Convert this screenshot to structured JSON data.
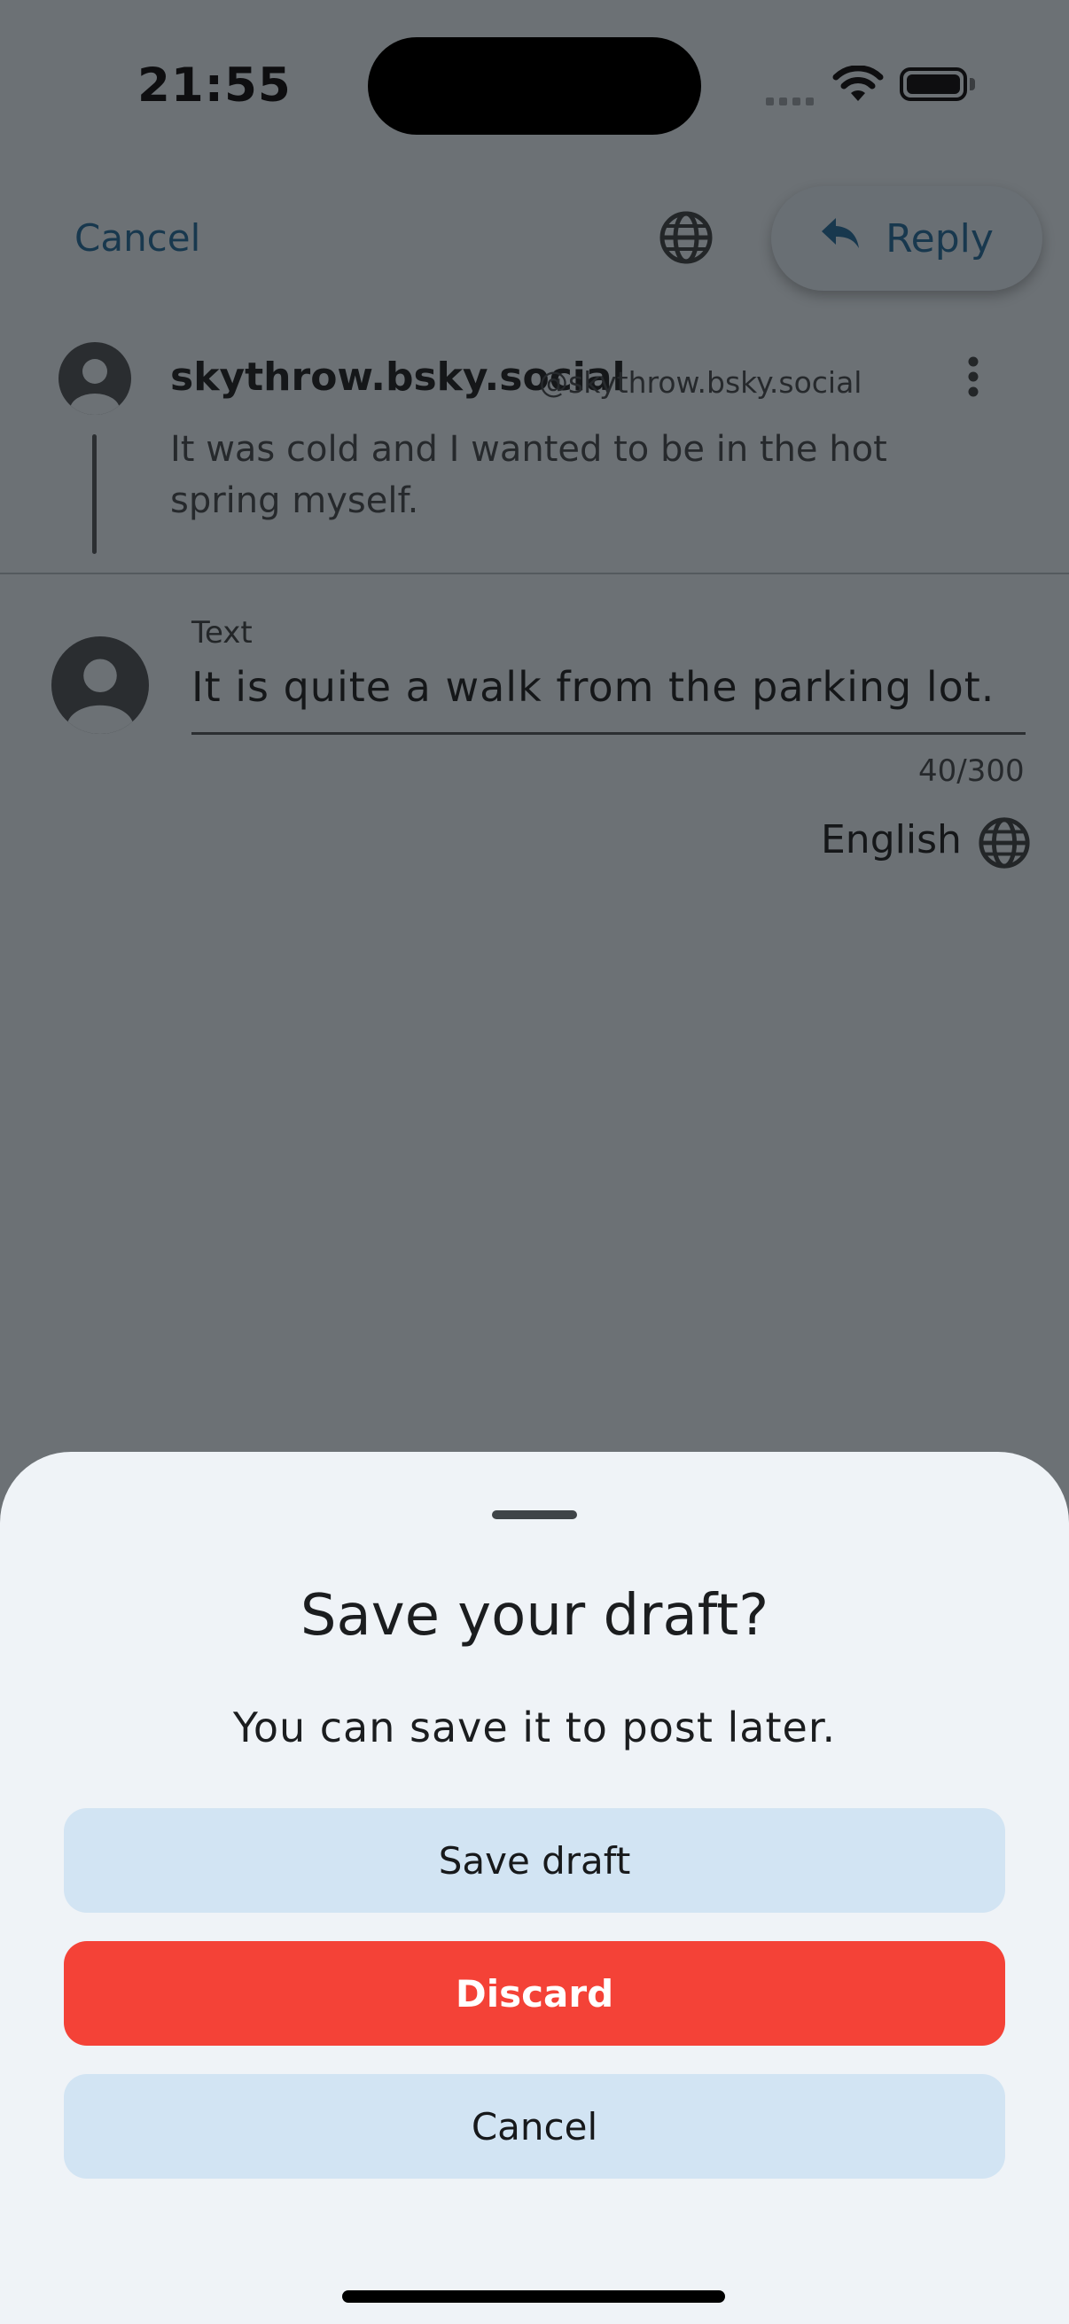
{
  "status_bar": {
    "time": "21:55"
  },
  "header": {
    "cancel_label": "Cancel",
    "reply_label": "Reply"
  },
  "parent_post": {
    "display_name": "skythrow.bsky.social",
    "handle": "@skythrow.bsky.social",
    "text": "It was cold and I wanted to be in the hot spring myself."
  },
  "composer": {
    "field_label": "Text",
    "value": "It is quite a walk from the parking lot.",
    "char_count": "40/300",
    "language": "English"
  },
  "sheet": {
    "title": "Save your draft?",
    "subtitle": "You can save it to post later.",
    "save_draft_label": "Save draft",
    "discard_label": "Discard",
    "cancel_label": "Cancel"
  },
  "colors": {
    "scrim": "#6c7175",
    "sheet_background": "#eff3f7",
    "secondary_button": "#d2e4f3",
    "discard_red": "#f44237",
    "link_blue": "#18384e"
  },
  "icons": [
    "globe-icon",
    "reply-arrow-icon",
    "avatar-icon",
    "more-vertical-icon",
    "wifi-icon",
    "battery-icon"
  ]
}
